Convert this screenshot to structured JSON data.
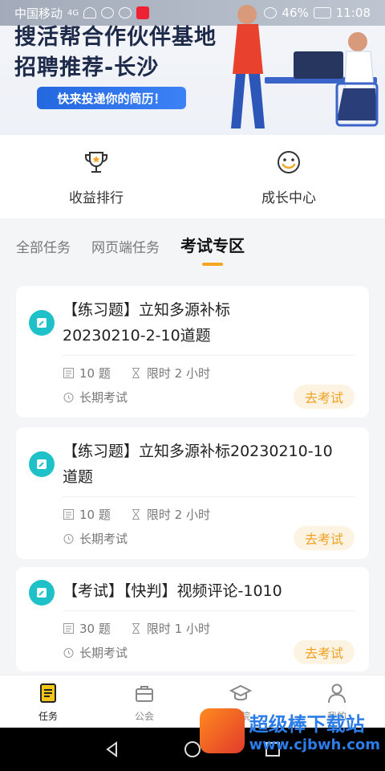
{
  "status_bar": {
    "carrier": "中国移动",
    "network": "4G",
    "battery": "46%",
    "time": "11:08"
  },
  "banner": {
    "title_line1": "搜活帮合作伙伴基地",
    "title_line2": "招聘推荐-长沙",
    "cta": "快来投递你的简历！"
  },
  "quick_links": [
    {
      "label": "收益排行",
      "icon": "trophy-icon"
    },
    {
      "label": "成长中心",
      "icon": "smile-icon"
    }
  ],
  "tabs": [
    {
      "label": "全部任务"
    },
    {
      "label": "网页端任务"
    },
    {
      "label": "考试专区"
    }
  ],
  "cards": [
    {
      "title": "【练习题】立知多源补标\n20230210-2-10道题",
      "count": "10 题",
      "time_limit": "限时 2 小时",
      "term": "长期考试",
      "action": "去考试"
    },
    {
      "title": "【练习题】立知多源补标20230210-10\n道题",
      "count": "10 题",
      "time_limit": "限时 2 小时",
      "term": "长期考试",
      "action": "去考试"
    },
    {
      "title": "【考试】【快判】视频评论-1010",
      "count": "30 题",
      "time_limit": "限时 1 小时",
      "term": "长期考试",
      "action": "去考试"
    }
  ],
  "bottom_nav": [
    {
      "label": "任务"
    },
    {
      "label": "公会"
    },
    {
      "label": "学院"
    },
    {
      "label": "我的"
    }
  ],
  "watermark": {
    "name": "超级棒下载站",
    "url": "www.cjbwh.com"
  },
  "colors": {
    "accent": "#f5a623",
    "teal": "#1fc1c8",
    "cta_blue": "#2468e0"
  }
}
